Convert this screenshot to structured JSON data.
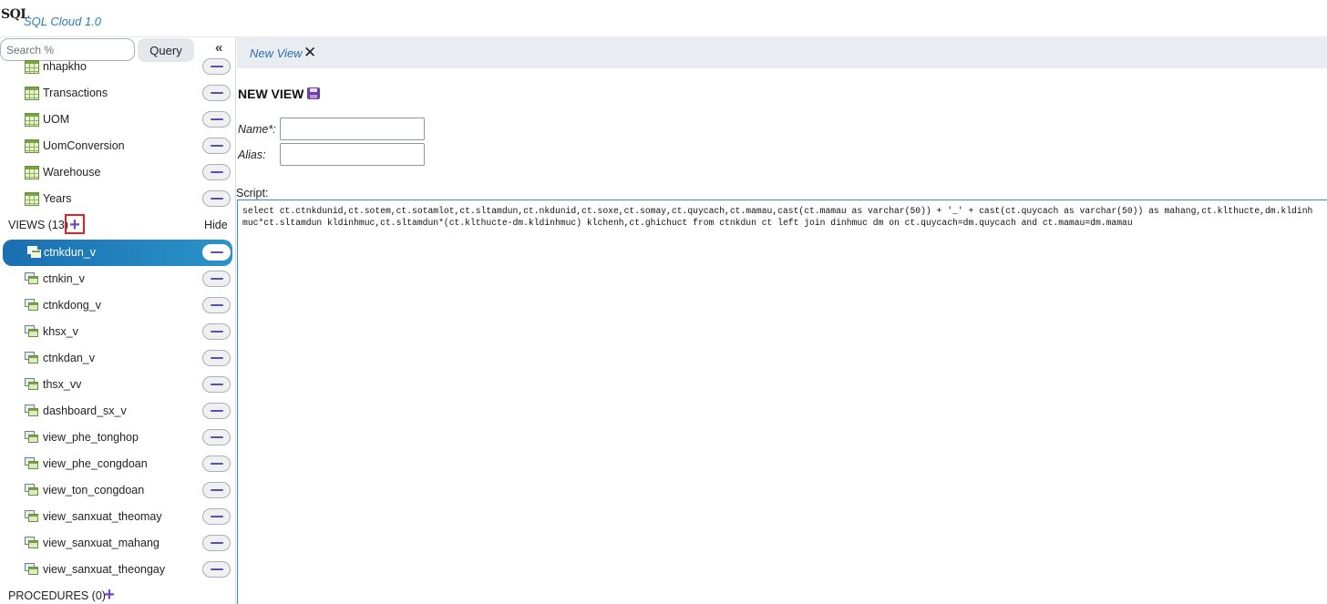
{
  "header": {
    "logo_text": "SQL",
    "app_title": "SQL Cloud 1.0"
  },
  "sidebar": {
    "search_placeholder": "Search %",
    "query_label": "Query",
    "collapse_glyph": "«",
    "tables": [
      {
        "label": "nhapkho",
        "icon": "table-icon"
      },
      {
        "label": "Transactions",
        "icon": "table-icon"
      },
      {
        "label": "UOM",
        "icon": "table-icon"
      },
      {
        "label": "UomConversion",
        "icon": "table-icon"
      },
      {
        "label": "Warehouse",
        "icon": "table-icon"
      },
      {
        "label": "Years",
        "icon": "table-icon"
      }
    ],
    "views_header": "VIEWS (13)",
    "hide_label": "Hide",
    "views": [
      {
        "label": "ctnkdun_v",
        "selected": true
      },
      {
        "label": "ctnkin_v"
      },
      {
        "label": "ctnkdong_v"
      },
      {
        "label": "khsx_v"
      },
      {
        "label": "ctnkdan_v"
      },
      {
        "label": "thsx_vv"
      },
      {
        "label": "dashboard_sx_v"
      },
      {
        "label": "view_phe_tonghop"
      },
      {
        "label": "view_phe_congdoan"
      },
      {
        "label": "view_ton_congdoan"
      },
      {
        "label": "view_sanxuat_theomay"
      },
      {
        "label": "view_sanxuat_mahang"
      },
      {
        "label": "view_sanxuat_theongay"
      }
    ],
    "procedures_header": "PROCEDURES (0)",
    "plus_glyph": "+"
  },
  "tab": {
    "label": "New View",
    "close_glyph": "✕"
  },
  "form": {
    "title": "NEW VIEW",
    "name_label": "Name*:",
    "name_value": "",
    "alias_label": "Alias:",
    "alias_value": "",
    "script_label": "Script:",
    "script_value": "select ct.ctnkdunid,ct.sotem,ct.sotamlot,ct.sltamdun,ct.nkdunid,ct.soxe,ct.somay,ct.quycach,ct.mamau,cast(ct.mamau as varchar(50)) + '_' + cast(ct.quycach as varchar(50)) as mahang,ct.klthucte,dm.kldinhmuc*ct.sltamdun kldinhmuc,ct.sltamdun*(ct.klthucte-dm.kldinhmuc) klchenh,ct.ghichuct from ctnkdun ct left join dinhmuc dm on ct.quycach=dm.quycach and ct.mamau=dm.mamau"
  },
  "colors": {
    "accent": "#2a93c9",
    "selected_start": "#1a6fb0",
    "plus": "#6a4cc4",
    "highlight_box": "#e0202a"
  }
}
